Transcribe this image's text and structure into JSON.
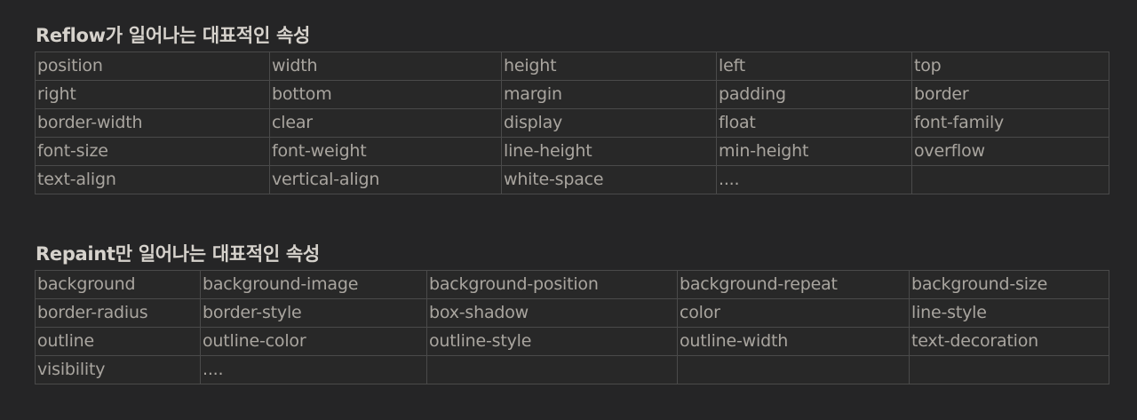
{
  "reflow": {
    "title": "Reflow가 일어나는 대표적인 속성",
    "rows": [
      [
        "position",
        "width",
        "height",
        "left",
        "top"
      ],
      [
        "right",
        "bottom",
        "margin",
        "padding",
        "border"
      ],
      [
        "border-width",
        "clear",
        "display",
        "float",
        "font-family"
      ],
      [
        "font-size",
        "font-weight",
        "line-height",
        "min-height",
        "overflow"
      ],
      [
        "text-align",
        "vertical-align",
        "white-space",
        "....",
        ""
      ]
    ]
  },
  "repaint": {
    "title": "Repaint만 일어나는 대표적인 속성",
    "rows": [
      [
        "background",
        "background-image",
        "background-position",
        "background-repeat",
        "background-size"
      ],
      [
        "border-radius",
        "border-style",
        "box-shadow",
        "color",
        "line-style"
      ],
      [
        "outline",
        "outline-color",
        "outline-style",
        "outline-width",
        "text-decoration"
      ],
      [
        "visibility",
        "....",
        "",
        "",
        ""
      ]
    ]
  },
  "colors": {
    "background": "#252526",
    "title": "#d6d2cc",
    "cell_text": "#a9a59f",
    "cell_border": "#4a4a4a"
  }
}
